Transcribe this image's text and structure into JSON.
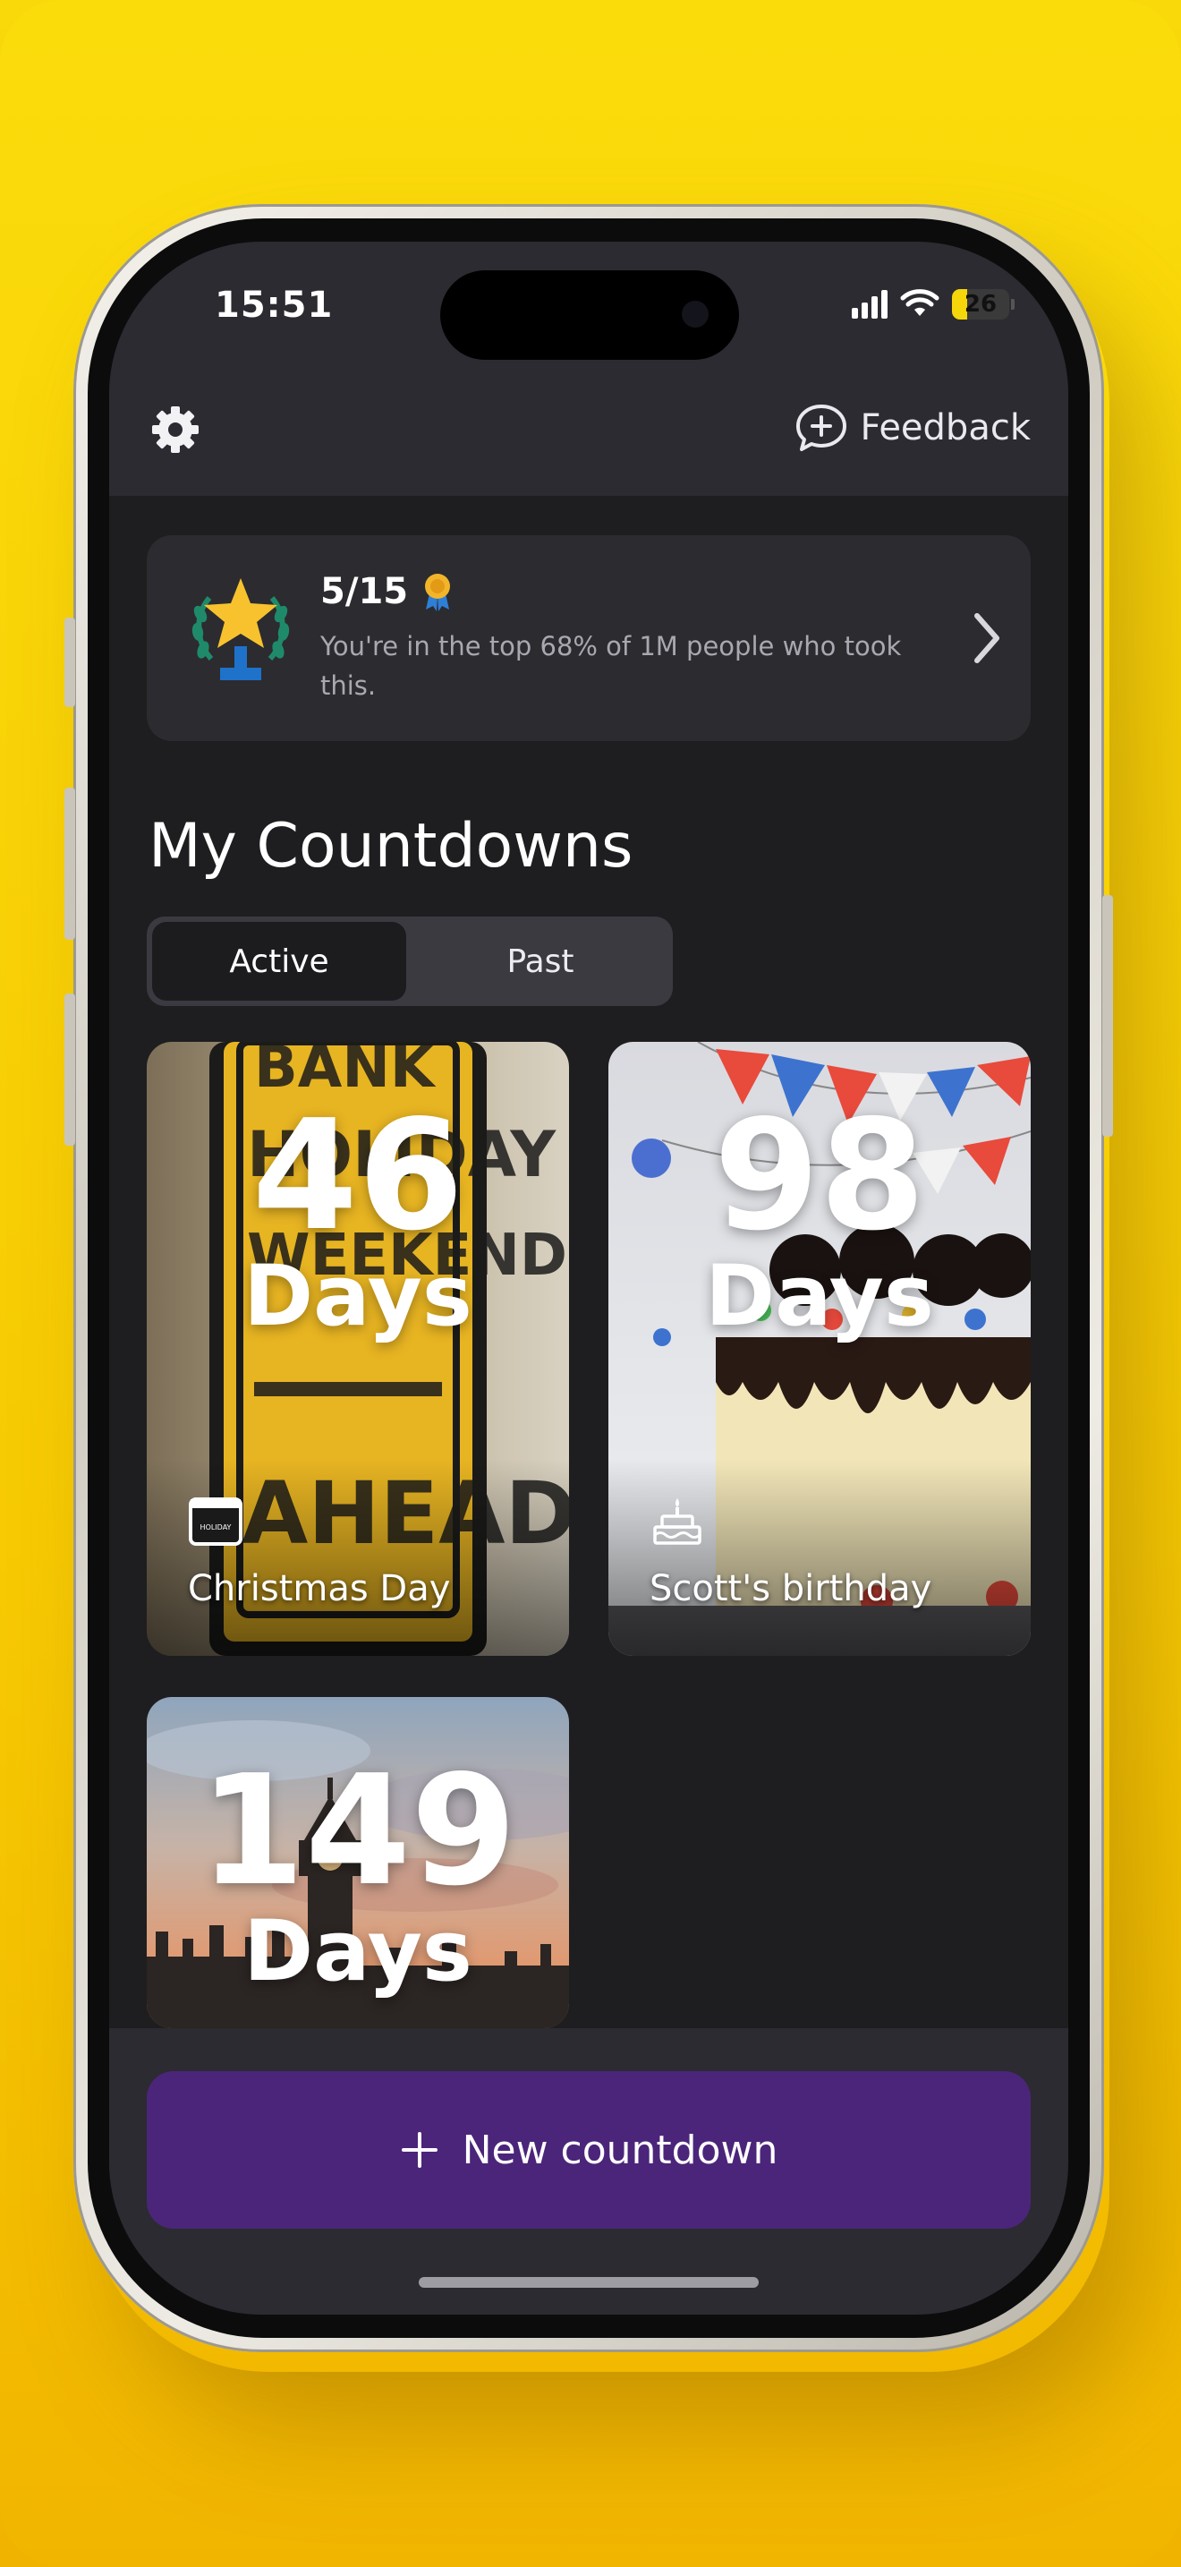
{
  "status_bar": {
    "time": "15:51",
    "battery": "26",
    "battery_level": 0.26
  },
  "header": {
    "feedback_label": "Feedback"
  },
  "quiz_card": {
    "score": "5/15",
    "text": "You're in the top 68% of 1M people who took this."
  },
  "countdowns": {
    "title": "My Countdowns",
    "tabs": [
      {
        "label": "Active",
        "selected": true
      },
      {
        "label": "Past",
        "selected": false
      }
    ],
    "items": [
      {
        "number": "46",
        "unit": "Days",
        "label": "Christmas Day",
        "category_icon": "holiday-icon",
        "badge": "HOLIDAY"
      },
      {
        "number": "98",
        "unit": "Days",
        "label": "Scott's birthday",
        "category_icon": "birthday-cake-icon"
      },
      {
        "number": "149",
        "unit": "Days",
        "label": ""
      }
    ]
  },
  "cta": {
    "label": "New countdown"
  },
  "colors": {
    "background": "#f7ca03",
    "cta": "#4b257a",
    "surface": "#2c2b31",
    "screen": "#1e1e20"
  }
}
